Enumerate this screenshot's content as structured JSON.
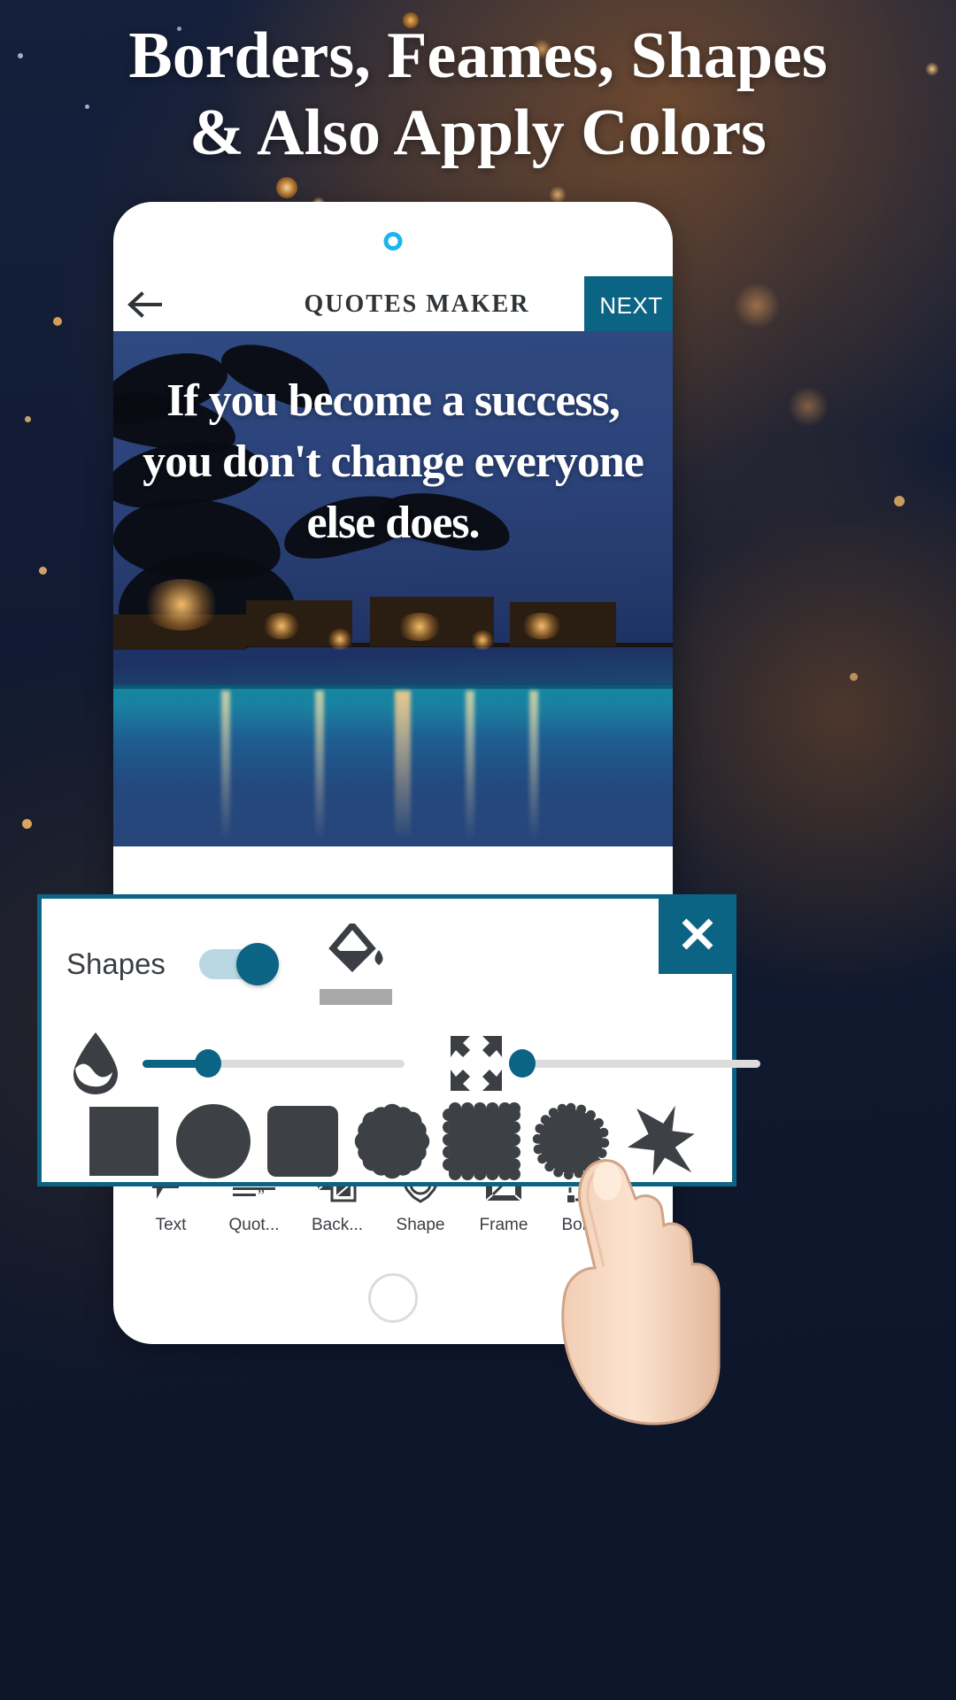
{
  "promo": {
    "headline_line1": "Borders, Feames, Shapes",
    "headline_line2": "& Also Apply Colors"
  },
  "colors": {
    "accent_teal": "#0b6483",
    "camera_ring": "#19b6ef",
    "shape_fill": "#3d4044",
    "panel_border": "#0b6483",
    "swatch_gray": "#a8a8a8",
    "backdrop_navy": "#121c35"
  },
  "phone": {
    "appbar": {
      "back_icon": "arrow-left-icon",
      "title": "QUOTES MAKER",
      "next_label": "NEXT"
    },
    "canvas": {
      "quote": "If you become a success, you don't change everyone else does."
    },
    "bottom_nav": [
      {
        "label": "Text",
        "icon": "text-edit-icon"
      },
      {
        "label": "Quot...",
        "icon": "quote-lines-icon"
      },
      {
        "label": "Back...",
        "icon": "background-layers-icon"
      },
      {
        "label": "Shape",
        "icon": "shape-star-icon"
      },
      {
        "label": "Frame",
        "icon": "frame-icon"
      },
      {
        "label": "Border",
        "icon": "border-dashed-icon"
      }
    ],
    "home_indicator": "home-ring"
  },
  "shapes_panel": {
    "title": "Shapes",
    "toggle_state": "on",
    "close_label": "×",
    "fill_tool": {
      "icon": "paint-bucket-icon",
      "swatch_color": "#a8a8a8"
    },
    "sliders": [
      {
        "name": "opacity",
        "icon": "water-drop-icon",
        "value_percent": 25
      },
      {
        "name": "size",
        "icon": "expand-arrows-icon",
        "value_percent": 2
      }
    ],
    "shapes": [
      {
        "name": "square",
        "icon": "square-shape-icon"
      },
      {
        "name": "circle",
        "icon": "circle-shape-icon"
      },
      {
        "name": "rounded-square",
        "icon": "rounded-square-shape-icon"
      },
      {
        "name": "flower",
        "icon": "flower-shape-icon"
      },
      {
        "name": "scalloped-square",
        "icon": "scalloped-square-shape-icon"
      },
      {
        "name": "gear-circle",
        "icon": "gear-circle-shape-icon"
      },
      {
        "name": "burst-star",
        "icon": "burst-star-shape-icon"
      }
    ]
  },
  "cursor": {
    "icon": "pointing-hand-cursor"
  }
}
